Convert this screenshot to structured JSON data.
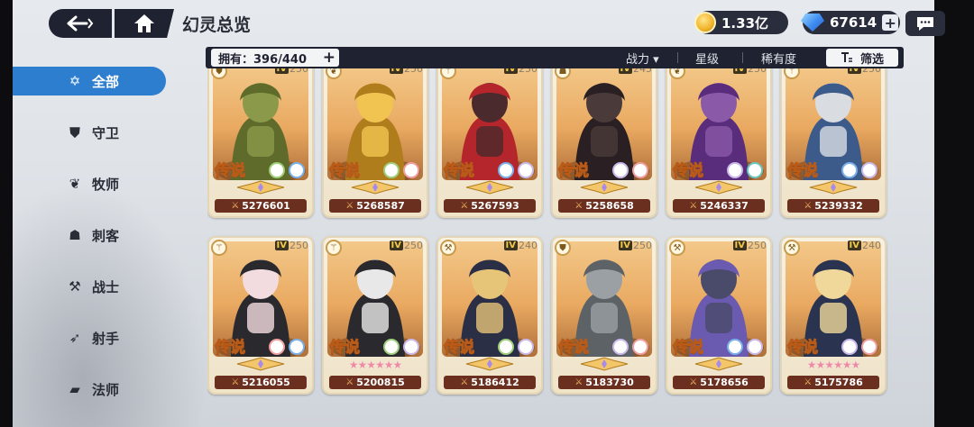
{
  "header": {
    "title": "幻灵总览"
  },
  "resources": {
    "gold": "1.33亿",
    "gems": "67614",
    "gems_plus": "+"
  },
  "filter": {
    "owned_label": "拥有：396/440",
    "owned_plus": "+",
    "sort_power": "战力",
    "sort_power_arrow": "▾",
    "sort_star": "星级",
    "sort_rarity": "稀有度",
    "filter_label": "筛选"
  },
  "sidebar": {
    "items": [
      {
        "label": "全部",
        "icon": "all-star-icon",
        "active": true
      },
      {
        "label": "守卫",
        "icon": "shield-icon",
        "active": false
      },
      {
        "label": "牧师",
        "icon": "leaf-icon",
        "active": false
      },
      {
        "label": "刺客",
        "icon": "hood-icon",
        "active": false
      },
      {
        "label": "战士",
        "icon": "axe-icon",
        "active": false
      },
      {
        "label": "射手",
        "icon": "bow-icon",
        "active": false
      },
      {
        "label": "法师",
        "icon": "book-icon",
        "active": false
      }
    ]
  },
  "cards": [
    {
      "power": "5276601",
      "level": "250",
      "rarity": "传说",
      "role": "shield-icon",
      "bg": "#8a9a4a",
      "accent": "#5e6b2a"
    },
    {
      "power": "5268587",
      "level": "250",
      "rarity": "传说",
      "role": "leaf-icon",
      "bg": "#f1c451",
      "accent": "#b07d1d"
    },
    {
      "power": "5267593",
      "level": "250",
      "rarity": "传说",
      "role": "staff-icon",
      "bg": "#4a2a2c",
      "accent": "#b4252c"
    },
    {
      "power": "5258658",
      "level": "245",
      "rarity": "传说",
      "role": "hood-icon",
      "bg": "#4a3b3a",
      "accent": "#2a1f22"
    },
    {
      "power": "5246337",
      "level": "250",
      "rarity": "传说",
      "role": "leaf-icon",
      "bg": "#8a5aa8",
      "accent": "#5a2c7c"
    },
    {
      "power": "5239332",
      "level": "250",
      "rarity": "传说",
      "role": "staff-icon",
      "bg": "#d9dde2",
      "accent": "#3c5a8a"
    },
    {
      "power": "5216055",
      "level": "250",
      "rarity": "传说",
      "role": "staff-icon",
      "bg": "#f2dce0",
      "accent": "#2a2a2e"
    },
    {
      "power": "5200815",
      "level": "250",
      "rarity": "传说",
      "role": "staff-icon",
      "bg": "#e8e8e8",
      "accent": "#2a2a2e"
    },
    {
      "power": "5186412",
      "level": "240",
      "rarity": "传说",
      "role": "axe-icon",
      "bg": "#e6c478",
      "accent": "#2a2f45"
    },
    {
      "power": "5183730",
      "level": "250",
      "rarity": "传说",
      "role": "shield-icon",
      "bg": "#9aa0a4",
      "accent": "#5c6266"
    },
    {
      "power": "5178656",
      "level": "250",
      "rarity": "传说",
      "role": "axe-icon",
      "bg": "#4a4a6a",
      "accent": "#6a5ab0"
    },
    {
      "power": "5175786",
      "level": "240",
      "rarity": "传说",
      "role": "axe-icon",
      "bg": "#f0d89a",
      "accent": "#2a3450"
    }
  ]
}
